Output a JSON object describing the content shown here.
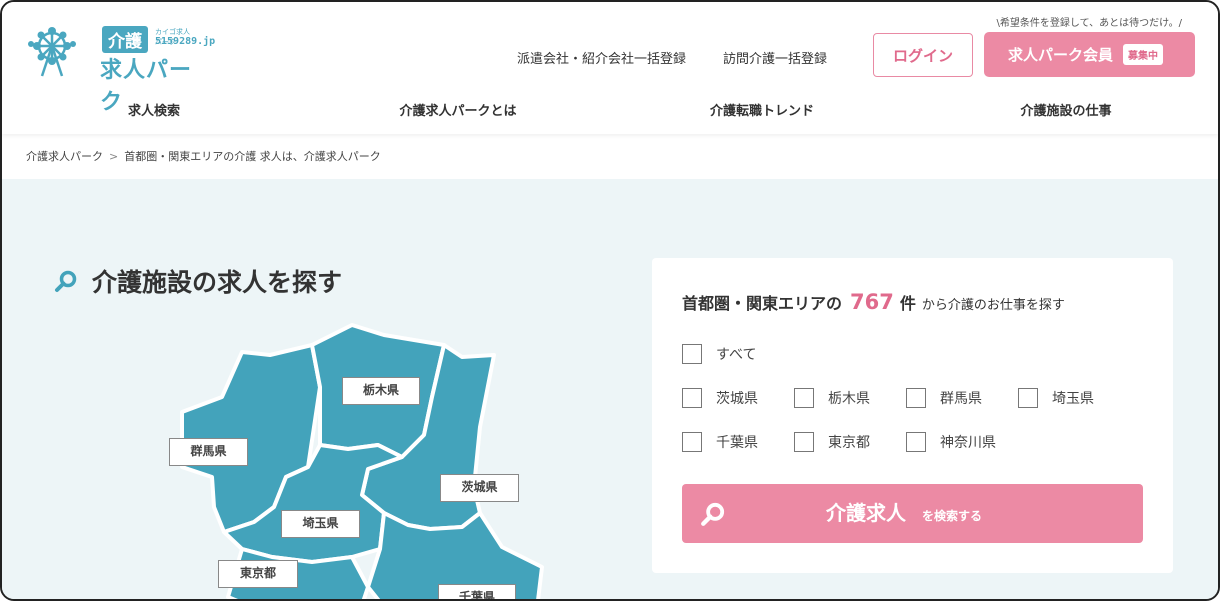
{
  "header": {
    "logo": {
      "tag": "介護",
      "small": "カイゴ求人パーク",
      "number": "5159289.jp",
      "name": "求人パーク"
    },
    "note": "\\希望条件を登録して、あとは待つだけ。/",
    "links": [
      "派遣会社・紹介会社一括登録",
      "訪問介護一括登録"
    ],
    "login": "ログイン",
    "member": {
      "label": "求人パーク会員",
      "badge": "募集中"
    }
  },
  "nav": [
    "求人検索",
    "介護求人パークとは",
    "介護転職トレンド",
    "介護施設の仕事"
  ],
  "breadcrumb": {
    "home": "介護求人パーク",
    "separator": ">",
    "current": "首都圏・関東エリアの介護 求人は、介護求人パーク"
  },
  "main": {
    "title": "介護施設の求人を探す",
    "map_labels": {
      "tochigi": "栃木県",
      "gunma": "群馬県",
      "ibaraki": "茨城県",
      "saitama": "埼玉県",
      "tokyo": "東京都",
      "chiba": "千葉県"
    },
    "colors": {
      "map": "#43a3bb",
      "accent": "#e06a8c",
      "button": "#ec8aa4",
      "background": "#edf5f7"
    }
  },
  "panel": {
    "area": "首都圏・関東エリアの",
    "count": "767",
    "unit": "件",
    "tail": "から介護のお仕事を探す",
    "options": {
      "all": "すべて",
      "ibaraki": "茨城県",
      "tochigi": "栃木県",
      "gunma": "群馬県",
      "saitama": "埼玉県",
      "chiba": "千葉県",
      "tokyo": "東京都",
      "kanagawa": "神奈川県"
    },
    "search_button": {
      "main": "介護求人",
      "small": "を検索する"
    }
  }
}
